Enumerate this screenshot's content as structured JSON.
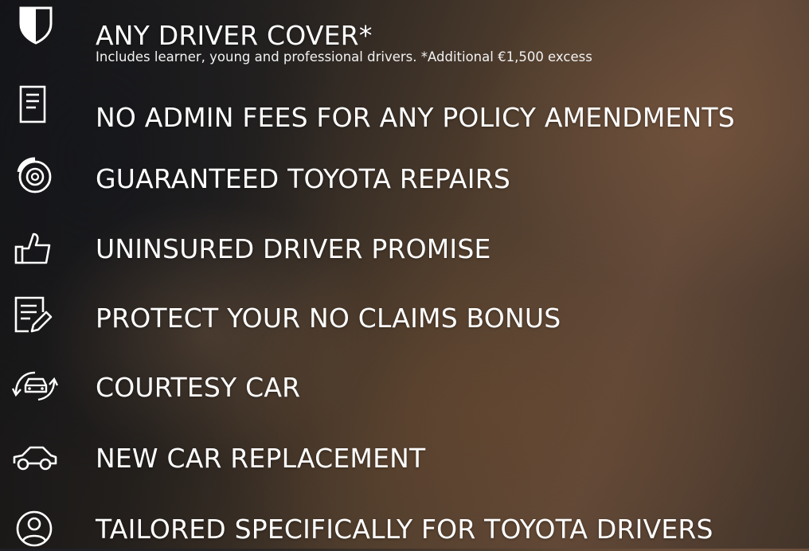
{
  "features": [
    {
      "label": "ANY DRIVER COVER*",
      "sub": "Includes learner, young and professional drivers. *Additional €1,500 excess",
      "icon": "shield-icon"
    },
    {
      "label": "NO ADMIN FEES FOR ANY POLICY AMENDMENTS",
      "icon": "document-icon"
    },
    {
      "label": "GUARANTEED TOYOTA REPAIRS",
      "icon": "brake-disc-icon"
    },
    {
      "label": "UNINSURED DRIVER PROMISE",
      "icon": "thumbs-up-icon"
    },
    {
      "label": "PROTECT YOUR NO CLAIMS BONUS",
      "icon": "document-edit-icon"
    },
    {
      "label": "COURTESY CAR",
      "icon": "car-swap-icon"
    },
    {
      "label": "NEW CAR REPLACEMENT",
      "icon": "car-side-icon"
    },
    {
      "label": "TAILORED SPECIFICALLY FOR TOYOTA DRIVERS",
      "icon": "user-circle-icon"
    }
  ],
  "colors": {
    "text": "#ffffff"
  }
}
